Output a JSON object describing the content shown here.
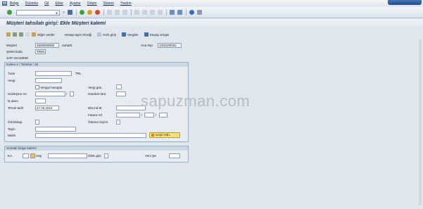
{
  "menu": [
    "Belge",
    "Düzenle",
    "Git",
    "Ekler",
    "Ayarlar",
    "Ortam",
    "Sistem",
    "Yardım"
  ],
  "title": "Müşteri tahsilatı girişi: Ekle Müşteri kalemi",
  "app_toolbar": {
    "other_data": "Diğer veriler",
    "account_model": "Hesap tayin örneği",
    "fast_entry": "Hızlı giriş",
    "taxes": "Vergiler",
    "withholding_tax": "Stopaj vergisi"
  },
  "header": {
    "customer_label": "Müşteri",
    "customer_value": "1500000069",
    "customer_desc": "nuhattt",
    "gl_label": "Ana hsp",
    "gl_value": "1201100001",
    "company_code_label": "Şirket kodu",
    "company_code_value": "TR00",
    "company_name": "SAP AKADEMİ"
  },
  "item_group": {
    "title": "Kalem 1 / Tahsilat / 15",
    "amount_label": "Tutar",
    "amount_value": "",
    "currency": "TRL",
    "tax_label": "Vergi",
    "calc_tax_label": "Vergiyi hesapla",
    "tax_code_label": "Vergi gös.",
    "contract_label": "Sözleşme no.",
    "flow_type_label": "Hareket türü",
    "business_area_label": "İş alanı",
    "baseline_date_label": "Temel tarih",
    "baseline_date_value": "27.05.2018",
    "net_due_label": "Nkt.ind.ttr.",
    "invoice_ref_label": "Fatura ref.",
    "payment_block_label": "Öd.blokajı",
    "payment_method_label": "Ödeme biçimi",
    "assignment_label": "Tayin",
    "text_label": "Metin",
    "long_text_button": "Uzun mtn."
  },
  "next_item": {
    "title": "Sonraki belge kalemi",
    "posting_key_label": "KA",
    "account_label": "Hsp",
    "special_gl_label": "ÖDK gös",
    "new_company_label": "Yeni ŞK"
  },
  "watermark": "sapuzman.com",
  "colors": {
    "background": "#dfe6ee",
    "title_text": "#1d2f4f",
    "field_border": "#8c9cb3",
    "detail_button": "#f7e27a"
  }
}
